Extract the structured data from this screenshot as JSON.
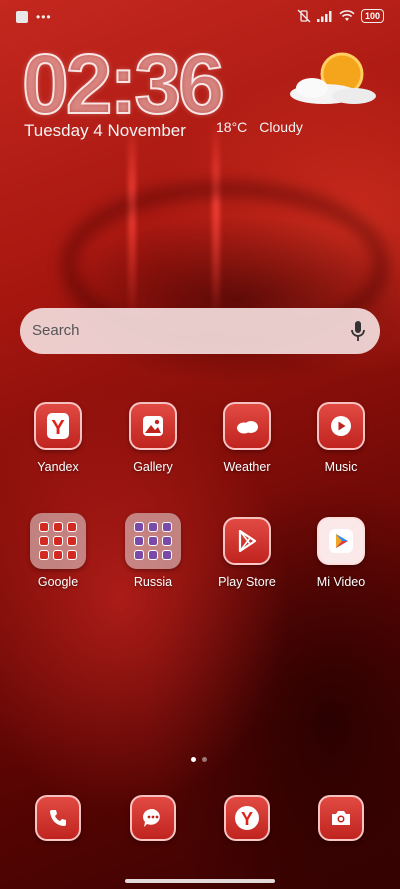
{
  "status_bar": {
    "battery": "100",
    "icons": [
      "notification-square-icon",
      "more-dots-icon",
      "vibrate-off-icon",
      "signal-icon",
      "wifi-icon",
      "battery-icon"
    ]
  },
  "lockscreen_widget": {
    "time": "02:36",
    "date": "Tuesday 4 November",
    "temperature": "18°C",
    "condition": "Cloudy",
    "weather_icon": "sun-behind-cloud-icon"
  },
  "search": {
    "placeholder": "Search",
    "icon": "mic-icon"
  },
  "apps_row1": [
    {
      "label": "Yandex",
      "icon": "yandex-icon"
    },
    {
      "label": "Gallery",
      "icon": "gallery-icon"
    },
    {
      "label": "Weather",
      "icon": "weather-icon"
    },
    {
      "label": "Music",
      "icon": "music-icon"
    }
  ],
  "apps_row2": [
    {
      "label": "Google",
      "icon": "folder-icon"
    },
    {
      "label": "Russia",
      "icon": "folder-icon"
    },
    {
      "label": "Play Store",
      "icon": "play-store-icon"
    },
    {
      "label": "Mi Video",
      "icon": "mi-video-icon"
    }
  ],
  "pager": {
    "pages": 2,
    "active": 1
  },
  "dock": [
    {
      "name": "phone",
      "icon": "phone-icon"
    },
    {
      "name": "messages",
      "icon": "messages-icon"
    },
    {
      "name": "yandex-browser",
      "icon": "yandex-browser-icon"
    },
    {
      "name": "camera",
      "icon": "camera-icon"
    }
  ],
  "colors": {
    "accent": "#c0241f",
    "icon_border": "#ffdcdc",
    "search_bg": "#f5e1e1"
  }
}
